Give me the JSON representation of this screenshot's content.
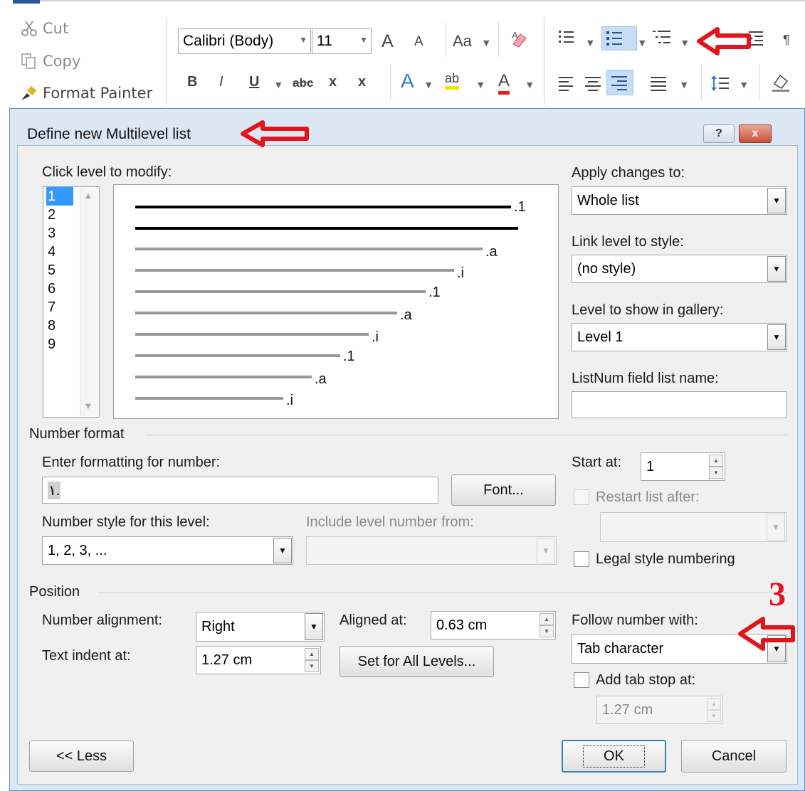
{
  "ribbon": {
    "clipboard": {
      "cut": "Cut",
      "copy": "Copy",
      "format_painter": "Format Painter"
    },
    "font": {
      "name": "Calibri (Body)",
      "size": "11",
      "grow": "A",
      "shrink": "A",
      "change_case": "Aa",
      "bold": "B",
      "italic": "I",
      "underline": "U",
      "strikethrough": "abc",
      "subscript": "x",
      "superscript": "x",
      "text_effects": "A",
      "highlight": "ab",
      "font_color": "A"
    }
  },
  "dialog": {
    "title": "Define new Multilevel list",
    "help": "?",
    "close": "x",
    "click_level_label": "Click level to modify:",
    "levels": [
      "1",
      "2",
      "3",
      "4",
      "5",
      "6",
      "7",
      "8",
      "9"
    ],
    "selected_level": "1",
    "preview_numbers": [
      ".1",
      ".a",
      ".i",
      ".1",
      ".a",
      ".i",
      ".1",
      ".a",
      ".i"
    ],
    "apply_changes_label": "Apply changes to:",
    "apply_changes_value": "Whole list",
    "link_level_label": "Link level to style:",
    "link_level_value": "(no style)",
    "gallery_level_label": "Level to show in gallery:",
    "gallery_level_value": "Level 1",
    "listnum_label": "ListNum field list name:",
    "listnum_value": "",
    "number_format_group": "Number format",
    "enter_formatting_label": "Enter formatting for number:",
    "enter_formatting_value": "١.",
    "font_button": "Font...",
    "start_at_label": "Start at:",
    "start_at_value": "1",
    "restart_list_label": "Restart list after:",
    "number_style_label": "Number style for this level:",
    "number_style_value": "1, 2, 3, ...",
    "include_level_label": "Include level number from:",
    "legal_style_label": "Legal style numbering",
    "position_group": "Position",
    "number_alignment_label": "Number alignment:",
    "number_alignment_value": "Right",
    "aligned_at_label": "Aligned at:",
    "aligned_at_value": "0.63 cm",
    "text_indent_label": "Text indent at:",
    "text_indent_value": "1.27 cm",
    "set_all_levels_button": "Set for All Levels...",
    "follow_number_label": "Follow number with:",
    "follow_number_value": "Tab character",
    "add_tab_stop_label": "Add tab stop at:",
    "add_tab_stop_value": "1.27 cm",
    "less_button": "<< Less",
    "ok_button": "OK",
    "cancel_button": "Cancel"
  },
  "annotation": {
    "number_label": "3",
    "color": "#e3121b"
  }
}
